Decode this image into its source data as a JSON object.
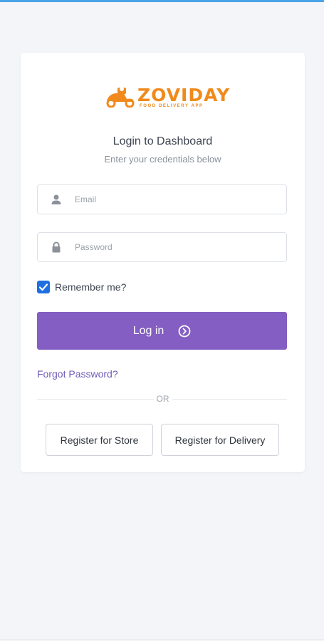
{
  "logo": {
    "name": "ZOVIDAY",
    "tagline": "FOOD DELIVERY APP",
    "color": "#f08a1c"
  },
  "header": {
    "title": "Login to Dashboard",
    "subtitle": "Enter your credentials below"
  },
  "form": {
    "email": {
      "placeholder": "Email",
      "value": "",
      "icon": "user-icon"
    },
    "password": {
      "placeholder": "Password",
      "value": "",
      "icon": "lock-icon"
    },
    "remember": {
      "label": "Remember me?",
      "checked": true
    },
    "login_button": {
      "label": "Log in",
      "icon": "arrow-circle-right-icon",
      "color": "#845ec2"
    },
    "forgot_link": "Forgot Password?"
  },
  "divider": {
    "label": "OR"
  },
  "register": {
    "store_label": "Register for Store",
    "delivery_label": "Register for Delivery"
  },
  "colors": {
    "background": "#f3f5f9",
    "accent": "#845ec2",
    "checkbox": "#1f6fe0",
    "top_bar": "#4aa3e8"
  }
}
